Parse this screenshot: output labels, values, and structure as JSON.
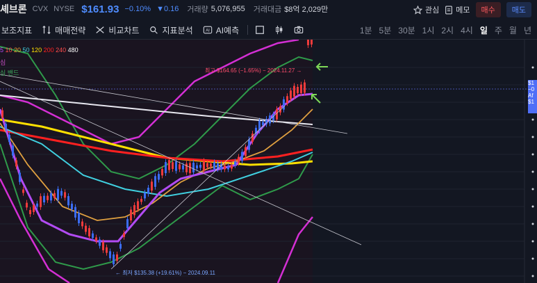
{
  "header": {
    "name": "셰브론",
    "ticker": "CVX",
    "exchange": "NYSE",
    "price": "$161.93",
    "change_pct": "−0.10%",
    "change_abs": "▼0.16",
    "volume_label": "거래량",
    "volume": "5,076,955",
    "amount_label": "거래대금",
    "amount": "$8억 2,029만",
    "watch_label": "관심",
    "memo_label": "메모",
    "buy_label": "매수",
    "sell_label": "매도"
  },
  "toolbar": {
    "items": [
      {
        "label": "보조지표",
        "icon": "indicator-icon"
      },
      {
        "label": "매매전략",
        "icon": "strategy-icon"
      },
      {
        "label": "비교차트",
        "icon": "compare-icon"
      },
      {
        "label": "지표분석",
        "icon": "analysis-icon"
      },
      {
        "label": "AI예측",
        "icon": "ai-icon"
      }
    ],
    "intervals": [
      "1분",
      "5분",
      "30분",
      "1시",
      "2시",
      "4시",
      "일",
      "주",
      "월",
      "년"
    ],
    "active_interval": "일"
  },
  "legend": {
    "ma": [
      "5",
      "10",
      "20",
      "50",
      "120",
      "200",
      "240",
      "480"
    ],
    "ma_colors": [
      "#b24bf3",
      "#ff4d4d",
      "#f0a030",
      "#40d0e0",
      "#ffe000",
      "#ff2020",
      "#ff4d4d",
      "#ffffff"
    ],
    "line2": "심",
    "line3": "심 밴드"
  },
  "annotations": {
    "high": "최고 $164.65 (−1.65%) − 2024.11.27 →",
    "low": "← 최저 $135.38 (+19.61%) − 2024.09.11"
  },
  "price_axis_tag": {
    "lines": [
      "$1",
      "−0",
      "Af",
      "$1"
    ]
  },
  "chart_data": {
    "type": "candlestick",
    "annotations": [
      "최고 $164.65 (−1.65%) − 2024.11.27",
      "최저 $135.38 (+19.61%) − 2024.09.11"
    ]
  }
}
